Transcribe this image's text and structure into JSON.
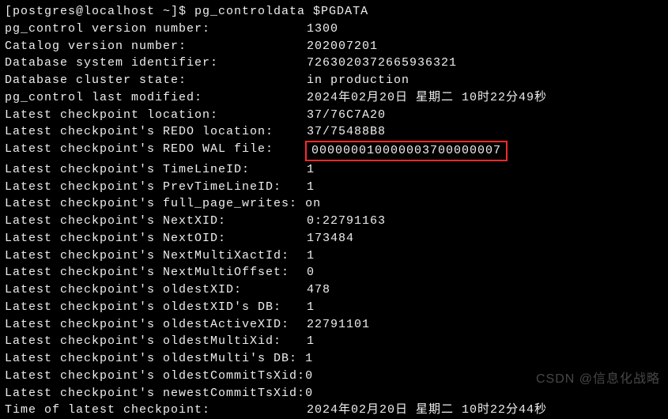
{
  "prompt": "[postgres@localhost ~]$ pg_controldata $PGDATA",
  "rows": [
    {
      "label": "pg_control version number:",
      "value": "1300"
    },
    {
      "label": "Catalog version number:",
      "value": "202007201"
    },
    {
      "label": "Database system identifier:",
      "value": "7263020372665936321"
    },
    {
      "label": "Database cluster state:",
      "value": "in production"
    },
    {
      "label": "pg_control last modified:",
      "value": "2024年02月20日 星期二 10时22分49秒"
    },
    {
      "label": "Latest checkpoint location:",
      "value": "37/76C7A20"
    },
    {
      "label": "Latest checkpoint's REDO location:",
      "value": "37/75488B8"
    },
    {
      "label": "Latest checkpoint's REDO WAL file:",
      "value": "000000010000003700000007",
      "boxed": true
    },
    {
      "label": "Latest checkpoint's TimeLineID:",
      "value": "1"
    },
    {
      "label": "Latest checkpoint's PrevTimeLineID:",
      "value": "1"
    },
    {
      "label": "Latest checkpoint's full_page_writes:",
      "value": " on",
      "tight": true
    },
    {
      "label": "Latest checkpoint's NextXID:",
      "value": "0:22791163"
    },
    {
      "label": "Latest checkpoint's NextOID:",
      "value": "173484"
    },
    {
      "label": "Latest checkpoint's NextMultiXactId:",
      "value": "1"
    },
    {
      "label": "Latest checkpoint's NextMultiOffset:",
      "value": "0"
    },
    {
      "label": "Latest checkpoint's oldestXID:",
      "value": "478"
    },
    {
      "label": "Latest checkpoint's oldestXID's DB:",
      "value": "1"
    },
    {
      "label": "Latest checkpoint's oldestActiveXID:",
      "value": "22791101"
    },
    {
      "label": "Latest checkpoint's oldestMultiXid:",
      "value": "1"
    },
    {
      "label": "Latest checkpoint's oldestMulti's DB:",
      "value": " 1",
      "tight": true
    },
    {
      "label": "Latest checkpoint's oldestCommitTsXid:",
      "value": "0",
      "tight": true
    },
    {
      "label": "Latest checkpoint's newestCommitTsXid:",
      "value": "0",
      "tight": true
    },
    {
      "label": "Time of latest checkpoint:",
      "value": "2024年02月20日 星期二 10时22分44秒"
    }
  ],
  "watermark": "CSDN @信息化战略"
}
